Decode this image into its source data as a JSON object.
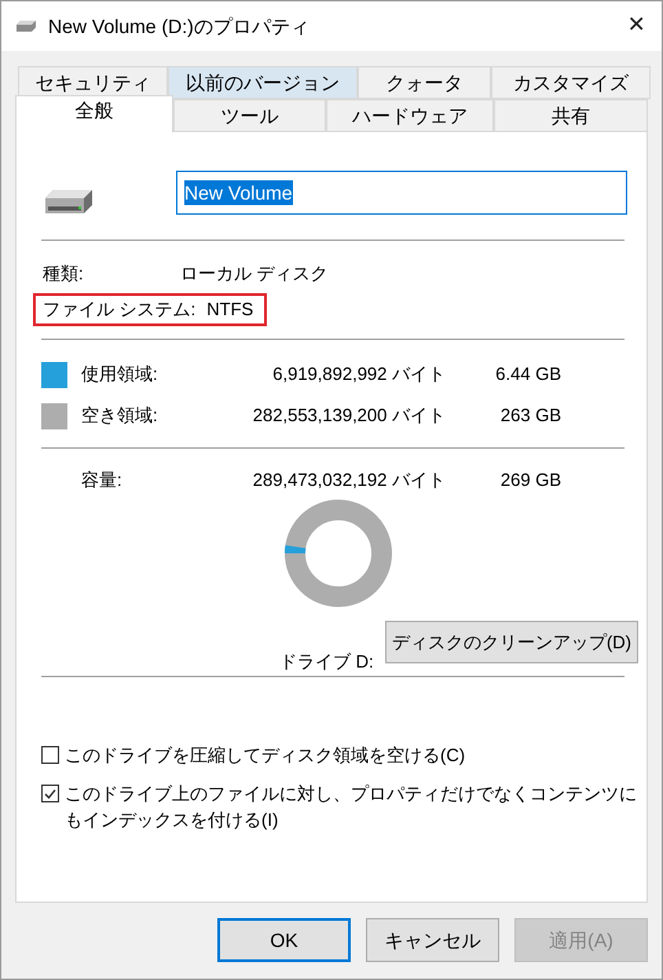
{
  "window": {
    "title": "New Volume (D:)のプロパティ",
    "close": "✕"
  },
  "tab_rows": [
    [
      {
        "label": "セキュリティ",
        "selected": false,
        "hovered": false
      },
      {
        "label": "以前のバージョン",
        "selected": false,
        "hovered": true
      },
      {
        "label": "クォータ",
        "selected": false,
        "hovered": false
      },
      {
        "label": "カスタマイズ",
        "selected": false,
        "hovered": false
      }
    ],
    [
      {
        "label": "全般",
        "selected": true,
        "hovered": false
      },
      {
        "label": "ツール",
        "selected": false,
        "hovered": false
      },
      {
        "label": "ハードウェア",
        "selected": false,
        "hovered": false
      },
      {
        "label": "共有",
        "selected": false,
        "hovered": false
      }
    ]
  ],
  "volume_name": {
    "value": "New Volume"
  },
  "info": [
    {
      "label": "種類:",
      "value": "ローカル ディスク",
      "highlighted": false
    },
    {
      "label": "ファイル システム:",
      "value": "NTFS",
      "highlighted": true
    }
  ],
  "usage": [
    {
      "label": "使用領域:",
      "bytes": "6,919,892,992 バイト",
      "size": "6.44 GB",
      "color": "#26a0da"
    },
    {
      "label": "空き領域:",
      "bytes": "282,553,139,200 バイト",
      "size": "263 GB",
      "color": "#adadad"
    }
  ],
  "capacity": {
    "label": "容量:",
    "bytes": "289,473,032,192 バイト",
    "size": "269 GB"
  },
  "donut": {
    "level": 0.024
  },
  "drive_label": "ドライブ D:",
  "cleanup_button": "ディスクのクリーンアップ(D)",
  "options": [
    {
      "label": "このドライブを圧縮してディスク領域を空ける(C)",
      "checked": false
    },
    {
      "label": "このドライブ上のファイルに対し、プロパティだけでなくコンテンツにもインデックスを付ける(I)",
      "checked": true
    }
  ],
  "buttons": [
    {
      "label": "OK",
      "focused": true,
      "disabled": false
    },
    {
      "label": "キャンセル",
      "focused": false,
      "disabled": false
    },
    {
      "label": "適用(A)",
      "focused": false,
      "disabled": true
    }
  ]
}
